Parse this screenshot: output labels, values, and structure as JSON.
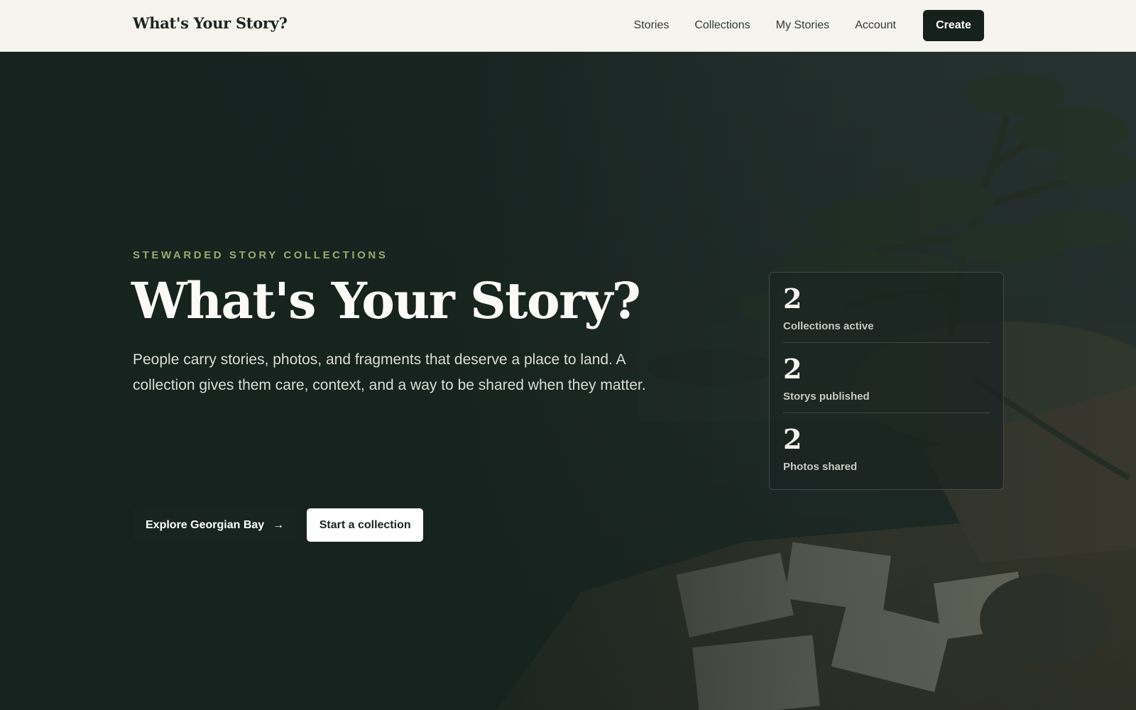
{
  "nav": {
    "brand": "What's Your Story?",
    "links": [
      "Stories",
      "Collections",
      "My Stories",
      "Account"
    ],
    "create_label": "Create"
  },
  "hero": {
    "eyebrow": "STEWARDED STORY COLLECTIONS",
    "title": "What's Your Story?",
    "description": "People carry stories, photos, and fragments that deserve a place to land. A collection gives them care, context, and a way to be shared when they matter.",
    "explore_label": "Explore Georgian Bay",
    "explore_icon": "arrow-right-icon",
    "start_label": "Start a collection"
  },
  "stats": [
    {
      "value": "2",
      "label": "Collections active"
    },
    {
      "value": "2",
      "label": "Storys published"
    },
    {
      "value": "2",
      "label": "Photos shared"
    }
  ],
  "colors": {
    "nav_bg": "#f5f4ef",
    "hero_bg": "#16231f",
    "accent": "#9aa96a",
    "primary_button": "#16201d"
  }
}
